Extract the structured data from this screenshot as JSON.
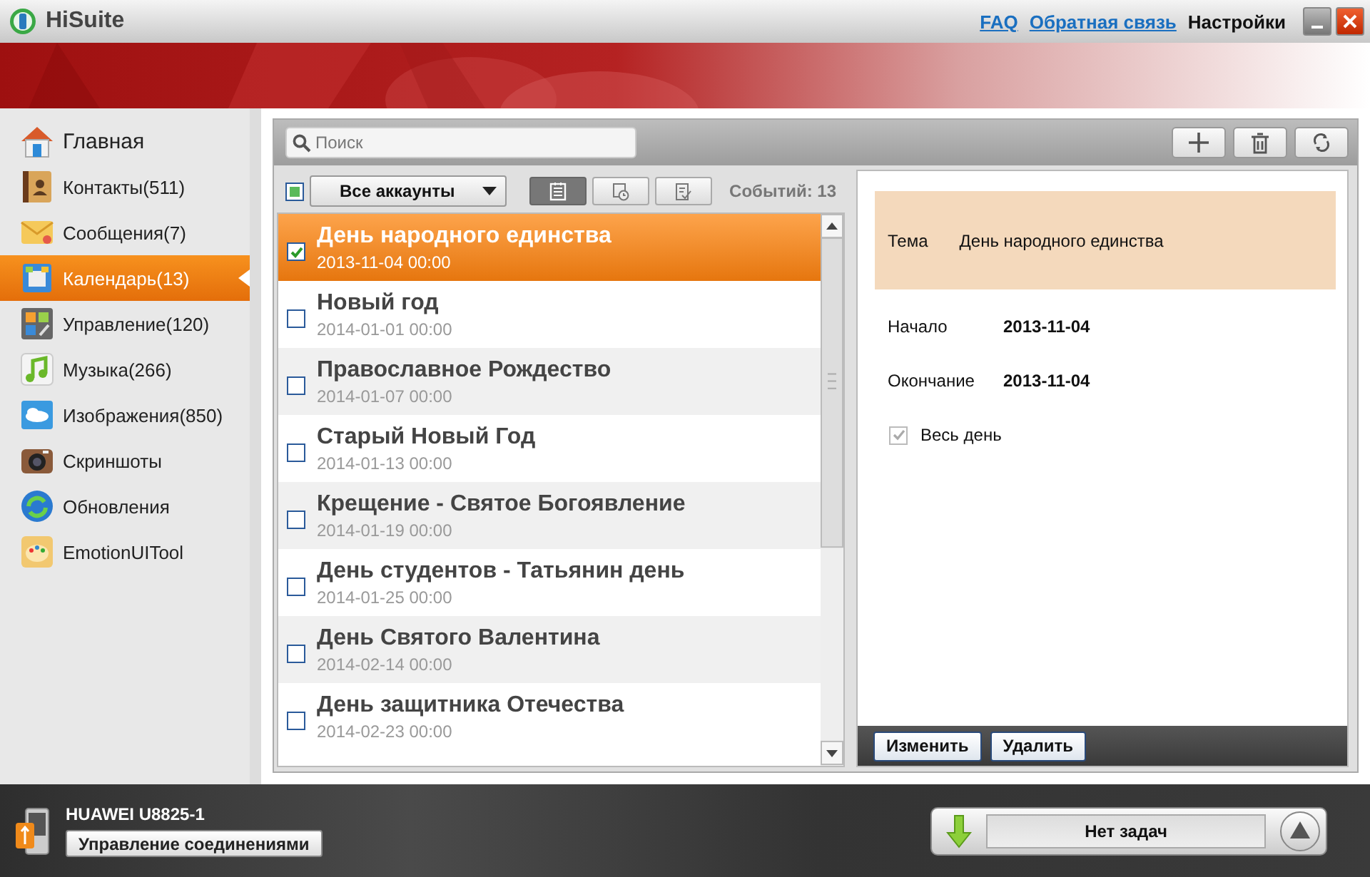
{
  "app": {
    "title": "HiSuite"
  },
  "header_links": [
    {
      "label": "FAQ",
      "kind": "link"
    },
    {
      "label": "Обратная связь",
      "kind": "link"
    },
    {
      "label": "Настройки",
      "kind": "plain"
    }
  ],
  "sidebar": {
    "items": [
      {
        "label": "Главная",
        "selected": false
      },
      {
        "label": "Контакты(511)",
        "selected": false
      },
      {
        "label": "Сообщения(7)",
        "selected": false
      },
      {
        "label": "Календарь(13)",
        "selected": true
      },
      {
        "label": "Управление(120)",
        "selected": false
      },
      {
        "label": "Музыка(266)",
        "selected": false
      },
      {
        "label": "Изображения(850)",
        "selected": false
      },
      {
        "label": "Скриншоты",
        "selected": false
      },
      {
        "label": "Обновления",
        "selected": false
      },
      {
        "label": "EmotionUITool",
        "selected": false
      }
    ]
  },
  "search": {
    "placeholder": "Поиск"
  },
  "filter": {
    "select_all": {
      "indeterminate": true
    },
    "account": "Все аккаунты",
    "view_buttons": [
      {
        "selected": true
      },
      {
        "selected": false
      },
      {
        "selected": false
      }
    ],
    "count": "Событий: 13"
  },
  "events": [
    {
      "title": "День народного единства",
      "date": "2013-11-04 00:00",
      "checked": true,
      "selected": true
    },
    {
      "title": "Новый год",
      "date": "2014-01-01 00:00",
      "checked": false,
      "selected": false
    },
    {
      "title": "Православное Рождество",
      "date": "2014-01-07 00:00",
      "checked": false,
      "selected": false
    },
    {
      "title": "Старый Новый Год",
      "date": "2014-01-13 00:00",
      "checked": false,
      "selected": false
    },
    {
      "title": "Крещение - Святое Богоявление",
      "date": "2014-01-19 00:00",
      "checked": false,
      "selected": false
    },
    {
      "title": "День студентов - Татьянин день",
      "date": "2014-01-25 00:00",
      "checked": false,
      "selected": false
    },
    {
      "title": "День Святого Валентина",
      "date": "2014-02-14 00:00",
      "checked": false,
      "selected": false
    },
    {
      "title": "День защитника Отечества",
      "date": "2014-02-23 00:00",
      "checked": false,
      "selected": false
    }
  ],
  "details": {
    "subject_label": "Тема",
    "subject": "День народного единства",
    "fields": [
      {
        "label": "Начало",
        "value": "2013-11-04"
      },
      {
        "label": "Окончание",
        "value": "2013-11-04"
      }
    ],
    "all_day": {
      "label": "Весь день",
      "checked": true,
      "disabled": true
    },
    "buttons": [
      "Изменить",
      "Удалить"
    ]
  },
  "status_bar": {
    "device": "HUAWEI U8825-1",
    "connection_button": "Управление соединениями",
    "tasks": "Нет задач"
  }
}
